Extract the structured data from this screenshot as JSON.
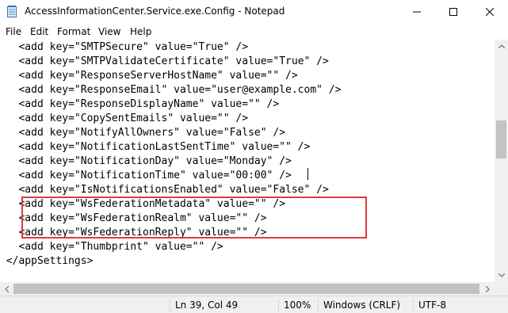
{
  "window": {
    "title": "AccessInformationCenter.Service.exe.Config - Notepad"
  },
  "menu": {
    "items": [
      "File",
      "Edit",
      "Format",
      "View",
      "Help"
    ]
  },
  "editor": {
    "lines": [
      "   <add key=\"SMTPSecure\" value=\"True\" />",
      "   <add key=\"SMTPValidateCertificate\" value=\"True\" />",
      "   <add key=\"ResponseServerHostName\" value=\"\" />",
      "   <add key=\"ResponseEmail\" value=\"user@example.com\" />",
      "   <add key=\"ResponseDisplayName\" value=\"\" />",
      "   <add key=\"CopySentEmails\" value=\"\" />",
      "   <add key=\"NotifyAllOwners\" value=\"False\" />",
      "   <add key=\"NotificationLastSentTime\" value=\"\" />",
      "   <add key=\"NotificationDay\" value=\"Monday\" />",
      "   <add key=\"NotificationTime\" value=\"00:00\" />",
      "   <add key=\"IsNotificationsEnabled\" value=\"False\" />",
      "   <add key=\"WsFederationMetadata\" value=\"\" />",
      "   <add key=\"WsFederationRealm\" value=\"\" />",
      "   <add key=\"WsFederationReply\" value=\"\" />",
      "   <add key=\"Thumbprint\" value=\"\" />",
      " </appSettings>"
    ],
    "highlight_color": "#e0393e"
  },
  "statusbar": {
    "position": "Ln 39, Col 49",
    "zoom": "100%",
    "line_ending": "Windows (CRLF)",
    "encoding": "UTF-8"
  }
}
